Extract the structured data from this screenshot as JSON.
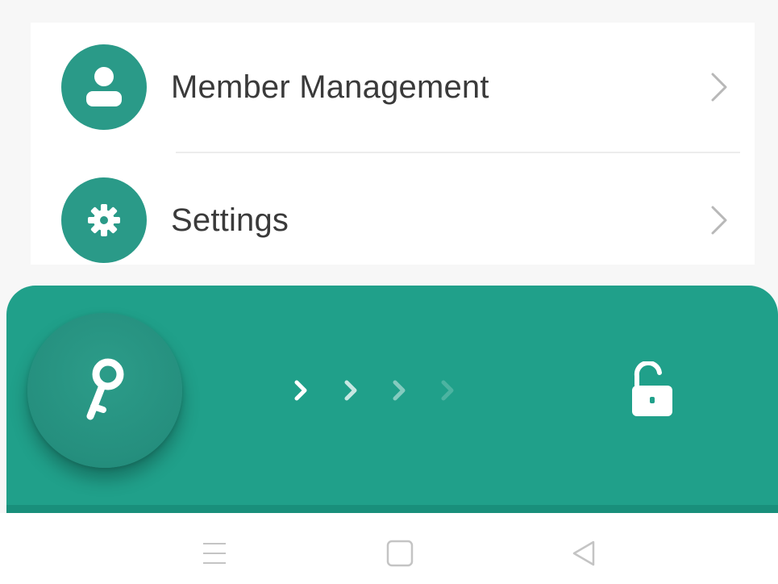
{
  "menu": {
    "items": [
      {
        "label": "Member Management",
        "icon": "person-icon"
      },
      {
        "label": "Settings",
        "icon": "gear-icon"
      }
    ]
  },
  "unlock_panel": {
    "slider_icon": "key-icon",
    "target_icon": "unlock-icon",
    "hint_icon": "swipe-right-arrows-icon"
  },
  "system_nav": {
    "buttons": [
      "menu-icon",
      "home-icon",
      "back-icon"
    ]
  },
  "colors": {
    "accent": "#20a08a",
    "icon_bg": "#2a9a88",
    "text": "#3a3a3a",
    "chevron": "#b8b8b8"
  }
}
